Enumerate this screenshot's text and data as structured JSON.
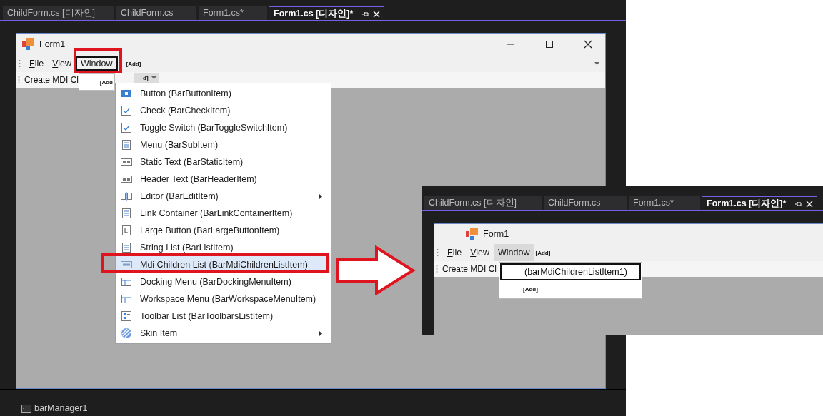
{
  "main": {
    "tabs": [
      {
        "label": "ChildForm.cs [디자인]",
        "selected": false
      },
      {
        "label": "ChildForm.cs",
        "selected": false
      },
      {
        "label": "Form1.cs*",
        "selected": false
      },
      {
        "label": "Form1.cs [디자인]*",
        "selected": true
      }
    ],
    "form": {
      "title": "Form1",
      "menu": [
        {
          "label": "File",
          "mnemonic": true,
          "selected": false
        },
        {
          "label": "View",
          "mnemonic": true,
          "selected": false
        },
        {
          "label": "Window",
          "mnemonic": false,
          "selected": true
        }
      ],
      "menu_add": "[Add]",
      "window_dropdown_add": "[Add",
      "toolbar_text": "Create MDI Cl",
      "toolbar_add_fragment": "d]"
    },
    "context_menu": {
      "items": [
        {
          "label": "Button (BarButtonItem)",
          "has_submenu": false,
          "selected": false
        },
        {
          "label": "Check (BarCheckItem)",
          "has_submenu": false,
          "selected": false
        },
        {
          "label": "Toggle Switch (BarToggleSwitchItem)",
          "has_submenu": false,
          "selected": false
        },
        {
          "label": "Menu (BarSubItem)",
          "has_submenu": false,
          "selected": false
        },
        {
          "label": "Static Text (BarStaticItem)",
          "has_submenu": false,
          "selected": false
        },
        {
          "label": "Header Text (BarHeaderItem)",
          "has_submenu": false,
          "selected": false
        },
        {
          "label": "Editor (BarEditItem)",
          "has_submenu": true,
          "selected": false
        },
        {
          "label": "Link Container (BarLinkContainerItem)",
          "has_submenu": false,
          "selected": false
        },
        {
          "label": "Large Button (BarLargeButtonItem)",
          "has_submenu": false,
          "selected": false
        },
        {
          "label": "String List (BarListItem)",
          "has_submenu": false,
          "selected": false
        },
        {
          "label": "Mdi Children List (BarMdiChildrenListItem)",
          "has_submenu": false,
          "selected": true
        },
        {
          "label": "Docking Menu (BarDockingMenuItem)",
          "has_submenu": false,
          "selected": false
        },
        {
          "label": "Workspace Menu (BarWorkspaceMenuItem)",
          "has_submenu": false,
          "selected": false
        },
        {
          "label": "Toolbar List (BarToolbarsListItem)",
          "has_submenu": false,
          "selected": false
        },
        {
          "label": "Skin Item",
          "has_submenu": true,
          "selected": false
        }
      ]
    },
    "tray_component": "barManager1"
  },
  "result": {
    "tabs": [
      {
        "label": "ChildForm.cs [디자인]",
        "selected": false
      },
      {
        "label": "ChildForm.cs",
        "selected": false
      },
      {
        "label": "Form1.cs*",
        "selected": false
      },
      {
        "label": "Form1.cs [디자인]*",
        "selected": true
      }
    ],
    "form": {
      "title": "Form1",
      "menu": [
        {
          "label": "File",
          "mnemonic": true,
          "selected": false
        },
        {
          "label": "View",
          "mnemonic": true,
          "selected": false
        },
        {
          "label": "Window",
          "mnemonic": false,
          "selected": true
        }
      ],
      "menu_add": "[Add]",
      "toolbar_text": "Create MDI Cl",
      "dropdown": [
        {
          "label": "(barMdiChildrenListItem1)",
          "kind": "item",
          "selected": true
        },
        {
          "label": "[Add]",
          "kind": "add",
          "selected": false
        }
      ]
    }
  }
}
